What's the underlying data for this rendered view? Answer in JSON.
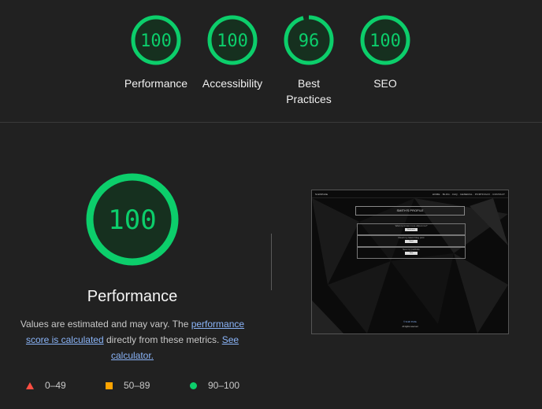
{
  "categories": [
    {
      "label": "Performance",
      "score": 100
    },
    {
      "label": "Accessibility",
      "score": 100
    },
    {
      "label": "Best Practices",
      "score": 96
    },
    {
      "label": "SEO",
      "score": 100
    }
  ],
  "main": {
    "score": 100,
    "title": "Performance",
    "desc_prefix": "Values are estimated and may vary. The ",
    "desc_link1": "performance score is calculated",
    "desc_middle": " directly from these metrics. ",
    "desc_link2": "See calculator."
  },
  "legend": [
    {
      "range": "0–49",
      "shape": "triangle",
      "color": "#ff4e42"
    },
    {
      "range": "50–89",
      "shape": "square",
      "color": "#ffa400"
    },
    {
      "range": "90–100",
      "shape": "circle",
      "color": "#0cce6b"
    }
  ],
  "colors": {
    "pass": "#0cce6b",
    "pass_bg": "#16301f",
    "average": "#ffa400",
    "fail": "#ff4e42",
    "link": "#8ab4f8"
  },
  "screenshot": {
    "brand": "SmithProfile",
    "nav_links": "HOME · BLOG · FAQ · GENERAL · PORTFOLIO · CONTACT",
    "title": "SMITH'S PROFILE",
    "cards": [
      {
        "text": "Want to know more about me?",
        "button": "Read more"
      },
      {
        "text": "Read my latest blog post",
        "button": "Read"
      },
      {
        "text": "See my portfolio",
        "button": "View"
      }
    ],
    "footer1": "© Smith Profile",
    "footer2": "All rights reserved"
  }
}
